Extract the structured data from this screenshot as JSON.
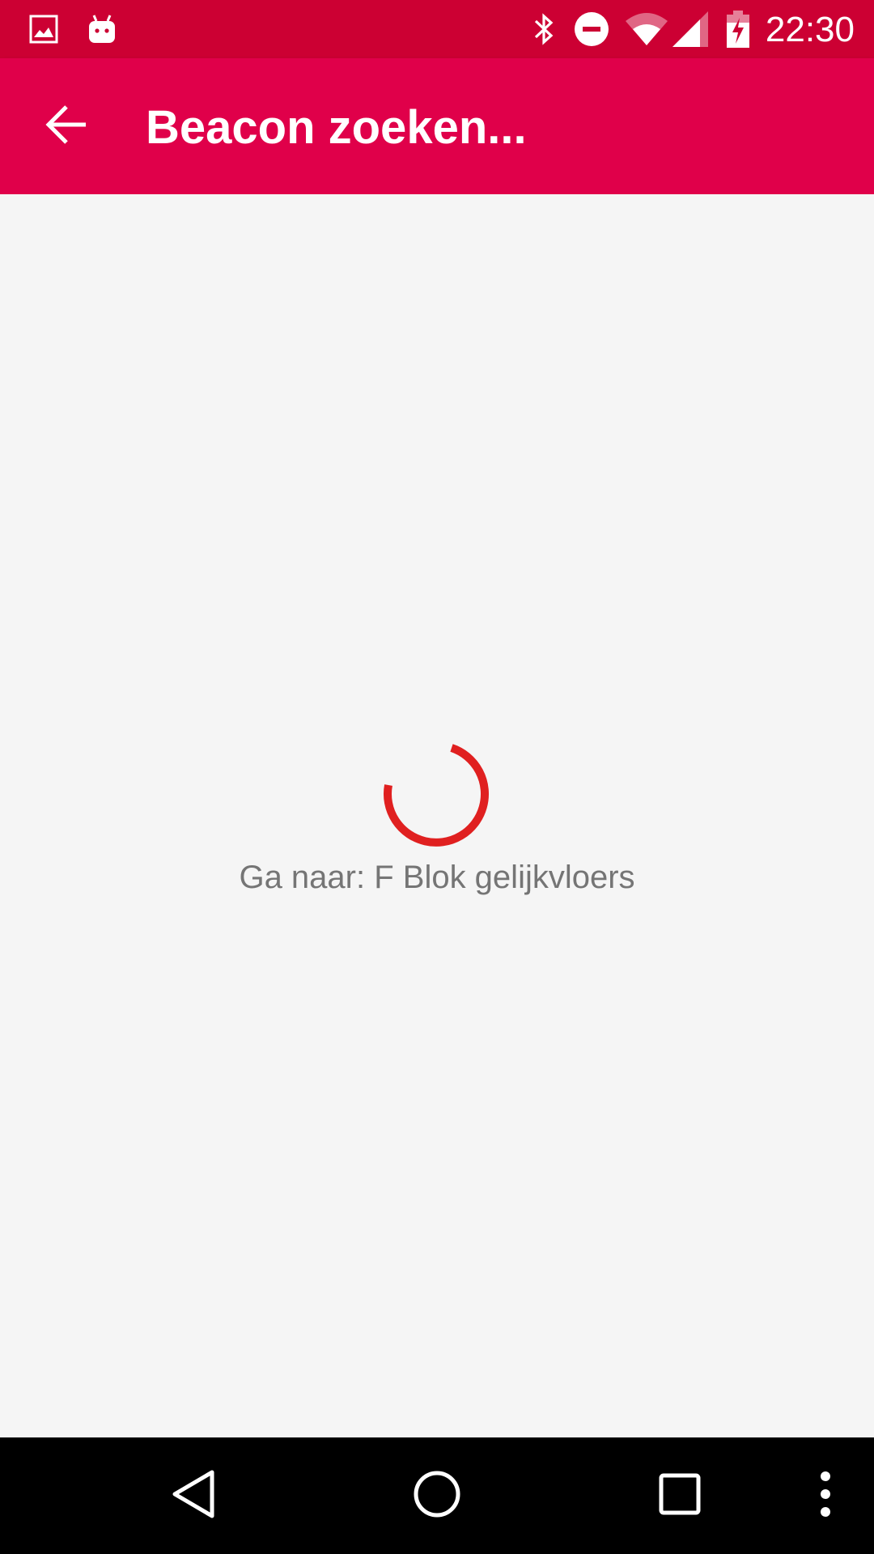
{
  "status_bar": {
    "time": "22:30",
    "left_icons": [
      "image-icon",
      "android-icon"
    ],
    "right_icons": [
      "bluetooth-icon",
      "do-not-disturb-icon",
      "wifi-icon",
      "cell-signal-icon",
      "battery-charging-icon"
    ],
    "background": "#cc0033"
  },
  "app_bar": {
    "title": "Beacon zoeken...",
    "back_icon": "arrow-back-icon",
    "background": "#e0004a"
  },
  "content": {
    "message": "Ga naar: F Blok gelijkvloers",
    "spinner_color": "#e02020",
    "background": "#f5f5f5"
  },
  "nav_bar": {
    "buttons": [
      "back-triangle-icon",
      "home-circle-icon",
      "recents-square-icon",
      "overflow-menu-icon"
    ],
    "background": "#000000"
  }
}
